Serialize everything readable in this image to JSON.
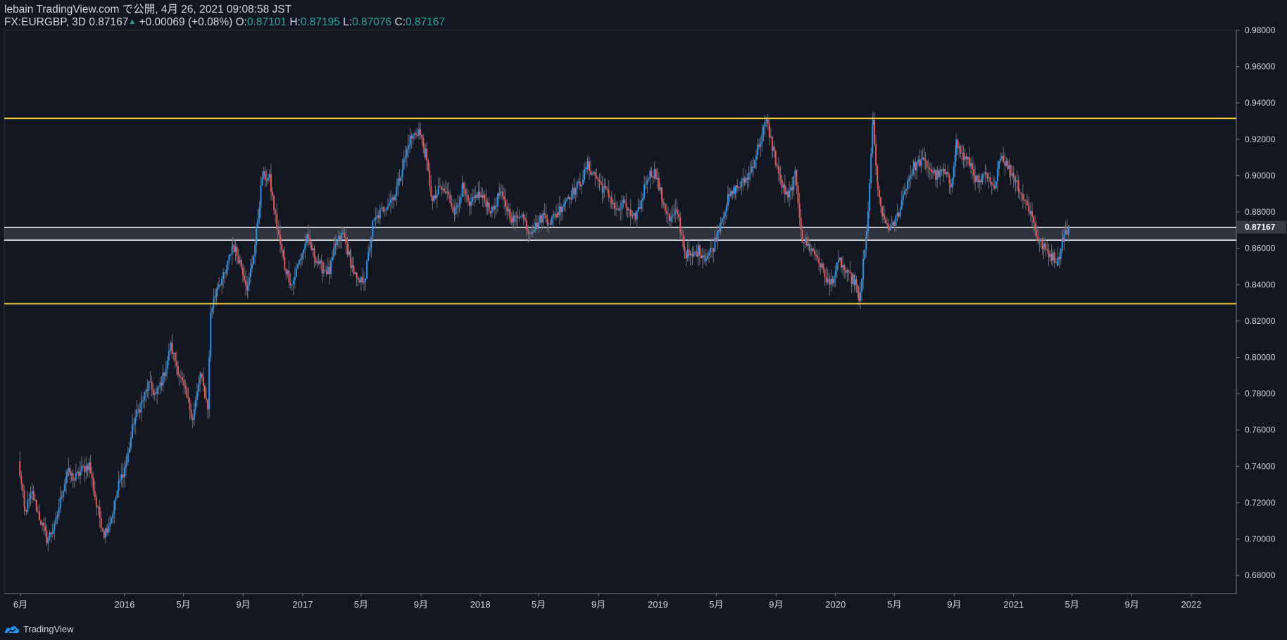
{
  "header": {
    "publisher": "lebain TradingView.com で公開, 4月 26, 2021 09:08:58 JST",
    "symbol": "FX:EURGBP, 3D",
    "last": "0.87167",
    "change": "+0.00069 (+0.08%)",
    "o_label": "O:",
    "o_value": "0.87101",
    "h_label": "H:",
    "h_value": "0.87195",
    "l_label": "L:",
    "l_value": "0.87076",
    "c_label": "C:",
    "c_value": "0.87167"
  },
  "footer": {
    "brand": "TradingView"
  },
  "colors": {
    "background": "#131722",
    "up_candle": "#2196f3",
    "down_candle": "#ef5350",
    "level_lines": "#f5d142",
    "zone_lines": "#ffffff",
    "axis_text": "#d1d4dc",
    "price_label_bg": "#363a45"
  },
  "chart_data": {
    "type": "candlestick",
    "title": "FX:EURGBP, 3D",
    "ylim": [
      0.67,
      0.98
    ],
    "y_ticks": [
      "0.98000",
      "0.96000",
      "0.94000",
      "0.92000",
      "0.90000",
      "0.88000",
      "0.86000",
      "0.84000",
      "0.82000",
      "0.80000",
      "0.78000",
      "0.76000",
      "0.74000",
      "0.72000",
      "0.70000",
      "0.68000"
    ],
    "x_ticks": [
      "6月",
      "2016",
      "5月",
      "9月",
      "2017",
      "5月",
      "9月",
      "2018",
      "5月",
      "9月",
      "2019",
      "5月",
      "9月",
      "2020",
      "5月",
      "9月",
      "2021",
      "5月",
      "9月",
      "2022"
    ],
    "x_tick_dates": [
      "2015-06-01",
      "2016-01-01",
      "2016-05-01",
      "2016-09-01",
      "2017-01-01",
      "2017-05-01",
      "2017-09-01",
      "2018-01-01",
      "2018-05-01",
      "2018-09-01",
      "2019-01-01",
      "2019-05-01",
      "2019-09-01",
      "2020-01-01",
      "2020-05-01",
      "2020-09-01",
      "2021-01-01",
      "2021-05-01",
      "2021-09-01",
      "2022-01-01"
    ],
    "last_price_label": "0.87167",
    "last_price": 0.87167,
    "horizontal_levels": [
      {
        "value": 0.9315,
        "color": "#f5d142"
      },
      {
        "value": 0.8295,
        "color": "#f5d142"
      }
    ],
    "zone": {
      "low": 0.8645,
      "high": 0.8715,
      "color": "#ffffff"
    },
    "price_path": [
      [
        "2015-05-28",
        0.742
      ],
      [
        "2015-06-10",
        0.715
      ],
      [
        "2015-06-25",
        0.725
      ],
      [
        "2015-07-10",
        0.712
      ],
      [
        "2015-07-25",
        0.7
      ],
      [
        "2015-08-10",
        0.706
      ],
      [
        "2015-08-25",
        0.725
      ],
      [
        "2015-09-05",
        0.737
      ],
      [
        "2015-09-20",
        0.733
      ],
      [
        "2015-10-05",
        0.738
      ],
      [
        "2015-10-20",
        0.741
      ],
      [
        "2015-11-05",
        0.718
      ],
      [
        "2015-11-20",
        0.703
      ],
      [
        "2015-12-05",
        0.712
      ],
      [
        "2015-12-20",
        0.73
      ],
      [
        "2016-01-05",
        0.742
      ],
      [
        "2016-01-20",
        0.765
      ],
      [
        "2016-02-05",
        0.775
      ],
      [
        "2016-02-20",
        0.785
      ],
      [
        "2016-03-05",
        0.779
      ],
      [
        "2016-03-20",
        0.789
      ],
      [
        "2016-04-05",
        0.806
      ],
      [
        "2016-04-20",
        0.793
      ],
      [
        "2016-05-05",
        0.78
      ],
      [
        "2016-05-20",
        0.767
      ],
      [
        "2016-06-05",
        0.79
      ],
      [
        "2016-06-20",
        0.773
      ],
      [
        "2016-06-26",
        0.825
      ],
      [
        "2016-07-10",
        0.84
      ],
      [
        "2016-07-25",
        0.845
      ],
      [
        "2016-08-10",
        0.862
      ],
      [
        "2016-08-25",
        0.853
      ],
      [
        "2016-09-10",
        0.838
      ],
      [
        "2016-09-25",
        0.862
      ],
      [
        "2016-10-10",
        0.9
      ],
      [
        "2016-10-25",
        0.898
      ],
      [
        "2016-11-10",
        0.87
      ],
      [
        "2016-11-25",
        0.85
      ],
      [
        "2016-12-10",
        0.84
      ],
      [
        "2016-12-25",
        0.853
      ],
      [
        "2017-01-10",
        0.865
      ],
      [
        "2017-01-25",
        0.856
      ],
      [
        "2017-02-10",
        0.849
      ],
      [
        "2017-02-25",
        0.847
      ],
      [
        "2017-03-10",
        0.862
      ],
      [
        "2017-03-25",
        0.868
      ],
      [
        "2017-04-10",
        0.852
      ],
      [
        "2017-04-25",
        0.84
      ],
      [
        "2017-05-10",
        0.845
      ],
      [
        "2017-05-25",
        0.873
      ],
      [
        "2017-06-10",
        0.88
      ],
      [
        "2017-06-25",
        0.885
      ],
      [
        "2017-07-10",
        0.89
      ],
      [
        "2017-07-25",
        0.905
      ],
      [
        "2017-08-10",
        0.92
      ],
      [
        "2017-08-28",
        0.925
      ],
      [
        "2017-09-10",
        0.912
      ],
      [
        "2017-09-25",
        0.885
      ],
      [
        "2017-10-10",
        0.893
      ],
      [
        "2017-10-25",
        0.89
      ],
      [
        "2017-11-10",
        0.88
      ],
      [
        "2017-11-25",
        0.893
      ],
      [
        "2017-12-10",
        0.882
      ],
      [
        "2017-12-25",
        0.89
      ],
      [
        "2018-01-10",
        0.887
      ],
      [
        "2018-01-25",
        0.88
      ],
      [
        "2018-02-10",
        0.89
      ],
      [
        "2018-02-25",
        0.882
      ],
      [
        "2018-03-10",
        0.875
      ],
      [
        "2018-03-25",
        0.88
      ],
      [
        "2018-04-10",
        0.87
      ],
      [
        "2018-04-25",
        0.872
      ],
      [
        "2018-05-10",
        0.878
      ],
      [
        "2018-05-25",
        0.875
      ],
      [
        "2018-06-10",
        0.88
      ],
      [
        "2018-06-25",
        0.887
      ],
      [
        "2018-07-10",
        0.891
      ],
      [
        "2018-07-25",
        0.896
      ],
      [
        "2018-08-10",
        0.905
      ],
      [
        "2018-08-25",
        0.9
      ],
      [
        "2018-09-10",
        0.893
      ],
      [
        "2018-09-25",
        0.888
      ],
      [
        "2018-10-10",
        0.88
      ],
      [
        "2018-10-25",
        0.885
      ],
      [
        "2018-11-10",
        0.875
      ],
      [
        "2018-11-25",
        0.883
      ],
      [
        "2018-12-10",
        0.9
      ],
      [
        "2018-12-25",
        0.902
      ],
      [
        "2019-01-10",
        0.887
      ],
      [
        "2019-01-25",
        0.875
      ],
      [
        "2019-02-10",
        0.88
      ],
      [
        "2019-02-25",
        0.858
      ],
      [
        "2019-03-10",
        0.855
      ],
      [
        "2019-03-25",
        0.859
      ],
      [
        "2019-04-10",
        0.855
      ],
      [
        "2019-04-25",
        0.861
      ],
      [
        "2019-05-10",
        0.875
      ],
      [
        "2019-05-25",
        0.887
      ],
      [
        "2019-06-10",
        0.893
      ],
      [
        "2019-06-25",
        0.896
      ],
      [
        "2019-07-10",
        0.902
      ],
      [
        "2019-07-25",
        0.915
      ],
      [
        "2019-08-12",
        0.93
      ],
      [
        "2019-08-25",
        0.915
      ],
      [
        "2019-09-10",
        0.897
      ],
      [
        "2019-09-25",
        0.887
      ],
      [
        "2019-10-10",
        0.9
      ],
      [
        "2019-10-25",
        0.865
      ],
      [
        "2019-11-10",
        0.86
      ],
      [
        "2019-11-25",
        0.855
      ],
      [
        "2019-12-10",
        0.845
      ],
      [
        "2019-12-20",
        0.84
      ],
      [
        "2020-01-10",
        0.853
      ],
      [
        "2020-01-25",
        0.845
      ],
      [
        "2020-02-10",
        0.842
      ],
      [
        "2020-02-18",
        0.83
      ],
      [
        "2020-03-05",
        0.868
      ],
      [
        "2020-03-18",
        0.93
      ],
      [
        "2020-03-28",
        0.89
      ],
      [
        "2020-04-10",
        0.875
      ],
      [
        "2020-04-25",
        0.87
      ],
      [
        "2020-05-10",
        0.88
      ],
      [
        "2020-05-25",
        0.895
      ],
      [
        "2020-06-10",
        0.905
      ],
      [
        "2020-06-25",
        0.908
      ],
      [
        "2020-07-10",
        0.905
      ],
      [
        "2020-07-25",
        0.9
      ],
      [
        "2020-08-10",
        0.902
      ],
      [
        "2020-08-25",
        0.895
      ],
      [
        "2020-09-05",
        0.918
      ],
      [
        "2020-09-20",
        0.91
      ],
      [
        "2020-10-05",
        0.906
      ],
      [
        "2020-10-20",
        0.895
      ],
      [
        "2020-11-05",
        0.9
      ],
      [
        "2020-11-20",
        0.892
      ],
      [
        "2020-12-05",
        0.912
      ],
      [
        "2020-12-20",
        0.905
      ],
      [
        "2021-01-05",
        0.898
      ],
      [
        "2021-01-20",
        0.888
      ],
      [
        "2021-02-05",
        0.88
      ],
      [
        "2021-02-20",
        0.865
      ],
      [
        "2021-03-05",
        0.86
      ],
      [
        "2021-03-20",
        0.856
      ],
      [
        "2021-04-02",
        0.853
      ],
      [
        "2021-04-12",
        0.866
      ],
      [
        "2021-04-26",
        0.87167
      ]
    ]
  }
}
